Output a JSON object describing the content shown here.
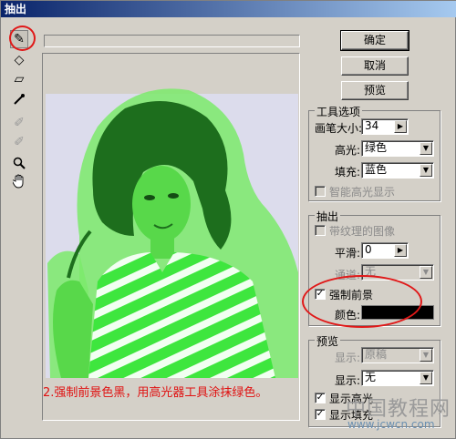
{
  "window": {
    "title": "抽出"
  },
  "toolbox": {
    "tools": [
      {
        "name": "edge-highlighter-icon",
        "glyph": "✎"
      },
      {
        "name": "fill-icon",
        "glyph": "◇"
      },
      {
        "name": "eraser-icon",
        "glyph": "▱"
      },
      {
        "name": "eyedropper-icon",
        "glyph": "⁄"
      },
      {
        "name": "cleanup-icon",
        "glyph": "✐"
      },
      {
        "name": "edge-touchup-icon",
        "glyph": "✐"
      },
      {
        "name": "zoom-icon",
        "glyph": "🔍"
      },
      {
        "name": "hand-icon",
        "glyph": "✋"
      }
    ]
  },
  "caption": "2.强制前景色黑，用高光器工具涂抹绿色。",
  "buttons": {
    "ok": "确定",
    "cancel": "取消",
    "preview": "预览"
  },
  "tool_options": {
    "title": "工具选项",
    "brush_size_label": "画笔大小:",
    "brush_size_value": "34",
    "highlight_label": "高光:",
    "highlight_value": "绿色",
    "fill_label": "填充:",
    "fill_value": "蓝色",
    "smart_highlight_label": "智能高光显示"
  },
  "extraction": {
    "title": "抽出",
    "textured_label": "带纹理的图像",
    "smooth_label": "平滑:",
    "smooth_value": "0",
    "channel_label": "通道:",
    "channel_value": "无",
    "force_fg_label": "强制前景",
    "color_label": "颜色:"
  },
  "preview_group": {
    "title": "预览",
    "show_label": "显示:",
    "show_value": "原稿",
    "display_label": "显示:",
    "display_value": "无",
    "show_highlight_label": "显示高光",
    "show_fill_label": "显示填充"
  },
  "watermark": {
    "main": "中国教程网",
    "sub": "www.jcwcn.com"
  },
  "colors": {
    "highlight": "#3ee63e",
    "caption": "#e01010",
    "photo_bg": "#dcdcec"
  }
}
